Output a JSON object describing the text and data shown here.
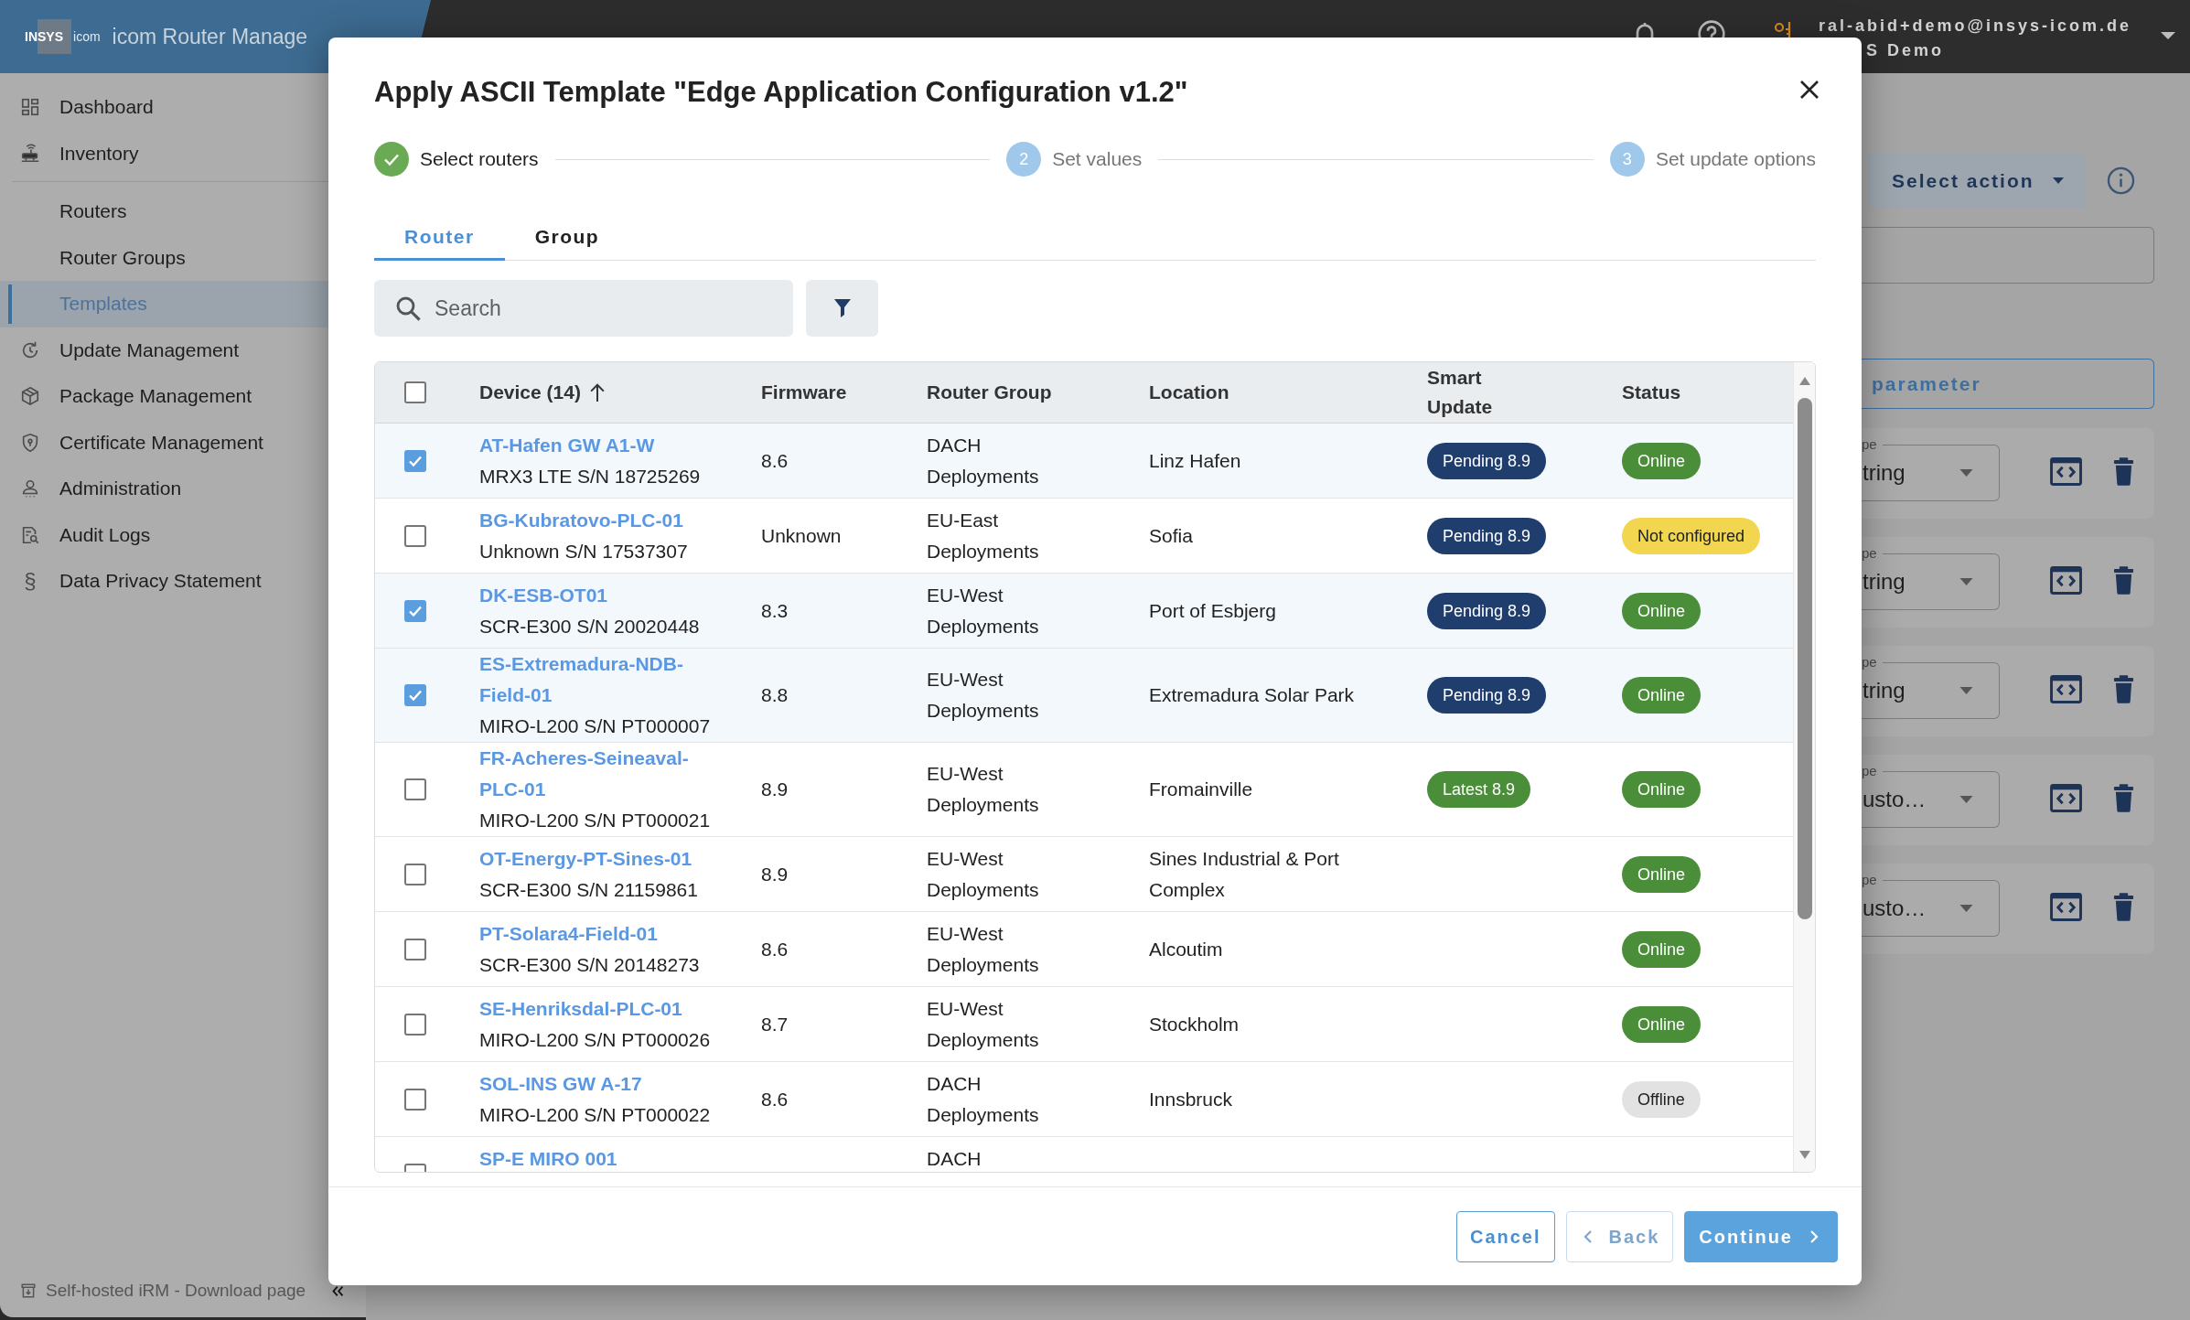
{
  "header": {
    "logo": {
      "brand": "INSYS",
      "product": "icom"
    },
    "app_title": "icom Router Manage",
    "user": {
      "email": "ral-abid+demo@insys-icom.de",
      "organization": "S Demo"
    }
  },
  "sidebar": {
    "items": [
      {
        "label": "Dashboard",
        "selected": false
      },
      {
        "label": "Inventory",
        "selected": false,
        "children": [
          {
            "label": "Routers",
            "selected": false
          },
          {
            "label": "Router Groups",
            "selected": false
          },
          {
            "label": "Templates",
            "selected": true
          }
        ]
      },
      {
        "label": "Update Management",
        "selected": false
      },
      {
        "label": "Package Management",
        "selected": false
      },
      {
        "label": "Certificate Management",
        "selected": false
      },
      {
        "label": "Administration",
        "selected": false
      },
      {
        "label": "Audit Logs",
        "selected": false
      },
      {
        "label": "Data Privacy Statement",
        "selected": false,
        "glyph": "§"
      }
    ],
    "footer_link": "Self-hosted iRM - Download page"
  },
  "page": {
    "action_button": "Select action",
    "add_button": "parameter",
    "parameters": [
      {
        "type_label": "pe",
        "type_value": "tring"
      },
      {
        "type_label": "pe",
        "type_value": "tring"
      },
      {
        "type_label": "pe",
        "type_value": "tring"
      },
      {
        "type_label": "pe",
        "type_value": "usto…"
      },
      {
        "type_label": "pe",
        "type_value": "usto…"
      }
    ]
  },
  "dialog": {
    "title": "Apply ASCII Template \"Edge Application Configuration v1.2\"",
    "steps": [
      {
        "label": "Select routers",
        "completed": true
      },
      {
        "number": "2",
        "label": "Set values",
        "completed": false
      },
      {
        "number": "3",
        "label": "Set update options",
        "completed": false
      }
    ],
    "tabs": [
      {
        "label": "Router",
        "selected": true
      },
      {
        "label": "Group",
        "selected": false
      }
    ],
    "search": {
      "placeholder": "Search"
    },
    "table": {
      "select_all": {
        "checked": false
      },
      "columns": [
        {
          "label": "Device (14)",
          "sorted": true
        },
        {
          "label": "Firmware",
          "sorted": false
        },
        {
          "label": "Router Group",
          "sorted": false
        },
        {
          "label": "Location",
          "sorted": false
        },
        {
          "label": "Smart Update",
          "sorted": false
        },
        {
          "label": "Status",
          "sorted": false
        }
      ],
      "rows": [
        {
          "checked": true,
          "device": "AT-Hafen GW A1-W",
          "serial": "MRX3 LTE S/N 18725269",
          "firmware": "8.6",
          "group": "DACH Deployments",
          "location": "Linz Hafen",
          "smart_update": {
            "label": "Pending 8.9",
            "color": "#1f3d6d"
          },
          "status": {
            "label": "Online",
            "color": "#4b8e3a"
          }
        },
        {
          "checked": false,
          "device": "BG-Kubratovo-PLC-01",
          "serial": "Unknown S/N 17537307",
          "firmware": "Unknown",
          "group": "EU-East Deployments",
          "location": "Sofia",
          "smart_update": {
            "label": "Pending 8.9",
            "color": "#1f3d6d"
          },
          "status": {
            "label": "Not configured",
            "color": "#f2d64f"
          }
        },
        {
          "checked": true,
          "device": "DK-ESB-OT01",
          "serial": "SCR-E300 S/N 20020448",
          "firmware": "8.3",
          "group": "EU-West Deployments",
          "location": "Port of Esbjerg",
          "smart_update": {
            "label": "Pending 8.9",
            "color": "#1f3d6d"
          },
          "status": {
            "label": "Online",
            "color": "#4b8e3a"
          }
        },
        {
          "checked": true,
          "device": "ES-Extremadura-NDB-Field-01",
          "serial": "MIRO-L200 S/N PT000007",
          "firmware": "8.8",
          "group": "EU-West Deployments",
          "location": "Extremadura Solar Park",
          "smart_update": {
            "label": "Pending 8.9",
            "color": "#1f3d6d"
          },
          "status": {
            "label": "Online",
            "color": "#4b8e3a"
          }
        },
        {
          "checked": false,
          "device": "FR-Acheres-Seineaval-PLC-01",
          "serial": "MIRO-L200 S/N PT000021",
          "firmware": "8.9",
          "group": "EU-West Deployments",
          "location": "Fromainville",
          "smart_update": {
            "label": "Latest 8.9",
            "color": "#4b8e3a"
          },
          "status": {
            "label": "Online",
            "color": "#4b8e3a"
          }
        },
        {
          "checked": false,
          "device": "OT-Energy-PT-Sines-01",
          "serial": "SCR-E300 S/N 21159861",
          "firmware": "8.9",
          "group": "EU-West Deployments",
          "location": "Sines Industrial & Port Complex",
          "status": {
            "label": "Online",
            "color": "#4b8e3a"
          }
        },
        {
          "checked": false,
          "device": "PT-Solara4-Field-01",
          "serial": "SCR-E300 S/N 20148273",
          "firmware": "8.6",
          "group": "EU-West Deployments",
          "location": "Alcoutim",
          "status": {
            "label": "Online",
            "color": "#4b8e3a"
          }
        },
        {
          "checked": false,
          "device": "SE-Henriksdal-PLC-01",
          "serial": "MIRO-L200 S/N PT000026",
          "firmware": "8.7",
          "group": "EU-West Deployments",
          "location": "Stockholm",
          "status": {
            "label": "Online",
            "color": "#4b8e3a"
          }
        },
        {
          "checked": false,
          "device": "SOL-INS GW A-17",
          "serial": "MIRO-L200 S/N PT000022",
          "firmware": "8.6",
          "group": "DACH Deployments",
          "location": "Innsbruck",
          "status": {
            "label": "Offline",
            "color": "#e2e2e2"
          }
        },
        {
          "checked": false,
          "device": "SP-E MIRO 001",
          "group": "DACH"
        }
      ]
    },
    "buttons": [
      {
        "kind": "cancel",
        "label": "Cancel",
        "disabled": false
      },
      {
        "kind": "back",
        "label": "Back",
        "disabled": true
      },
      {
        "kind": "next",
        "label": "Continue",
        "disabled": false
      }
    ]
  }
}
